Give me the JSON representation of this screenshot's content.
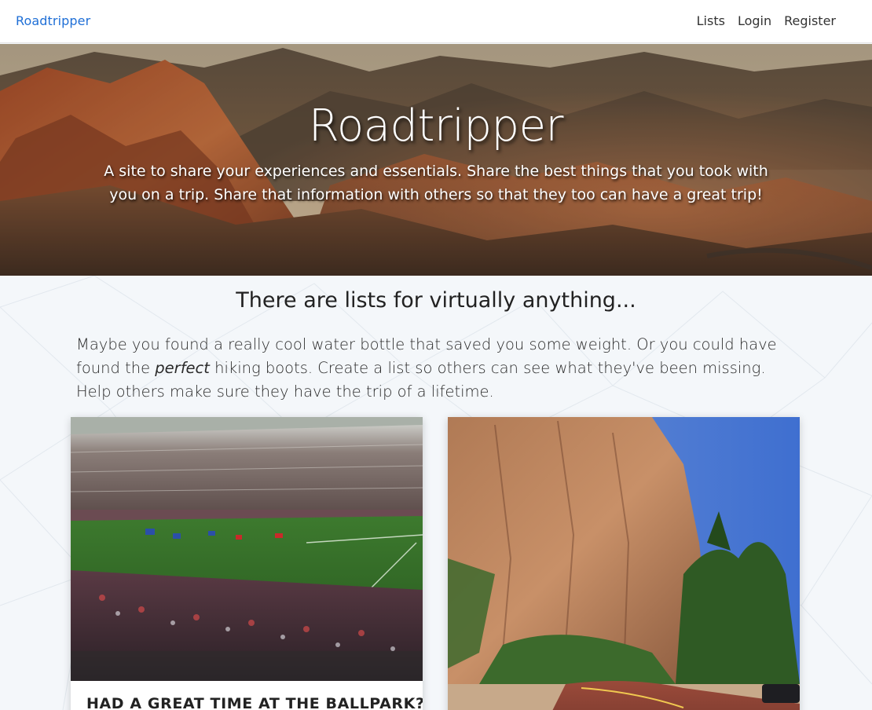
{
  "navbar": {
    "brand": "Roadtripper",
    "links": [
      "Lists",
      "Login",
      "Register"
    ]
  },
  "hero": {
    "title": "Roadtripper",
    "subtitle": "A site to share your experiences and essentials. Share the best things that you took with you on a trip. Share that information with others so that they too can have a great trip!"
  },
  "section": {
    "heading": "There are lists for virtually anything...",
    "intro_part1": "Maybe you found a really cool water bottle that saved you some weight. Or you could have found the ",
    "intro_emphasis": "perfect",
    "intro_part2": " hiking boots. Create a list so others can see what they've been missing. Help others make sure they have the trip of a lifetime."
  },
  "cards": [
    {
      "title": "HAD A GREAT TIME AT THE BALLPARK?",
      "image": "stadium-photo"
    },
    {
      "title": "",
      "image": "canyon-road-photo"
    }
  ],
  "colors": {
    "brand": "#1f6fd6",
    "page_bg": "#f4f7fa"
  }
}
